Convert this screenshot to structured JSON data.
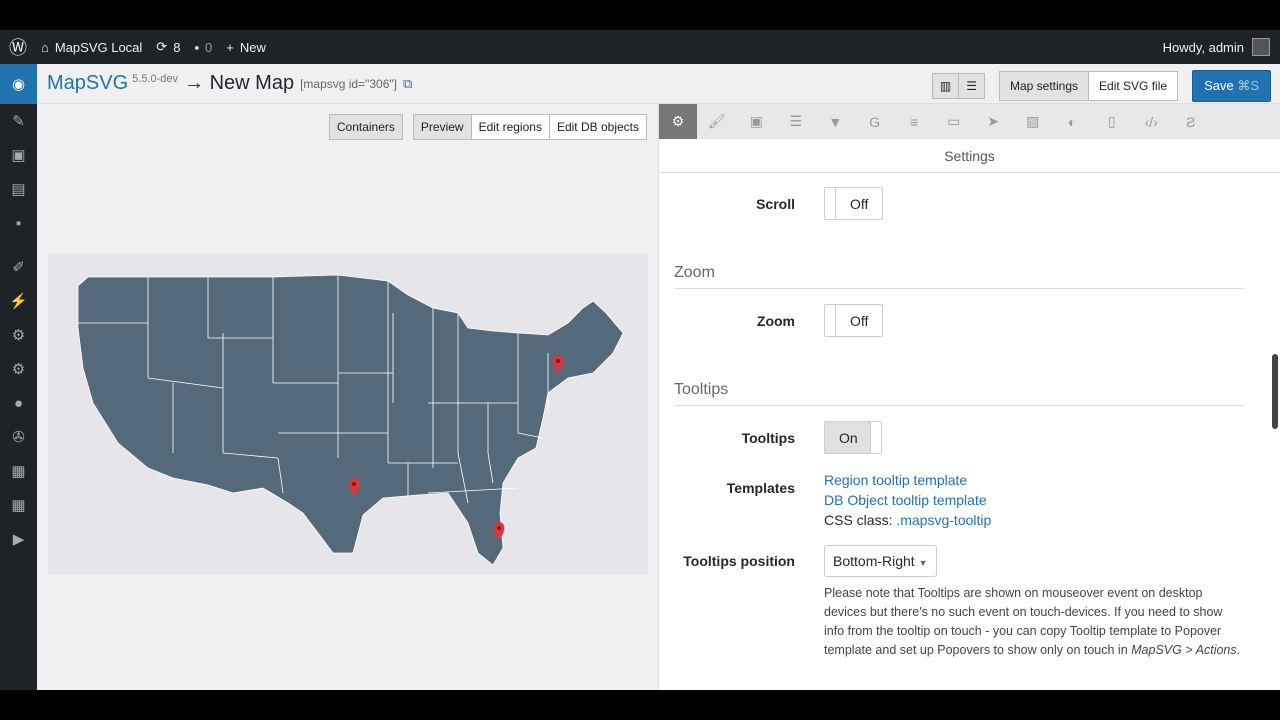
{
  "adminbar": {
    "site": "MapSVG Local",
    "updates": "8",
    "comments": "0",
    "new": "New",
    "howdy": "Howdy, admin"
  },
  "header": {
    "brand": "MapSVG",
    "version": "5.5.0-dev",
    "title": "→ New Map",
    "shortcode": "[mapsvg id=\"306\"]",
    "map_settings": "Map settings",
    "edit_svg": "Edit SVG file",
    "save": "Save",
    "save_shortcut": "⌘S"
  },
  "left": {
    "containers": "Containers",
    "preview": "Preview",
    "edit_regions": "Edit regions",
    "edit_db": "Edit DB objects"
  },
  "right": {
    "settings_title": "Settings",
    "scroll_label": "Scroll",
    "scroll_value": "Off",
    "zoom_section": "Zoom",
    "zoom_label": "Zoom",
    "zoom_value": "Off",
    "tooltips_section": "Tooltips",
    "tooltips_label": "Tooltips",
    "tooltips_value": "On",
    "templates_label": "Templates",
    "region_tpl": "Region tooltip template",
    "db_tpl": "DB Object tooltip template",
    "css_prefix": "CSS class: ",
    "css_class": ".mapsvg-tooltip",
    "position_label": "Tooltips position",
    "position_value": "Bottom-Right",
    "note": "Please note that Tooltips are shown on mouseover event on desktop devices but there's no such event on touch-devices. If you need to show info from the tooltip on touch - you can copy Tooltip template to Popover template and set up Popovers to show only on touch in ",
    "note_path": "MapSVG > Actions",
    "note_end": "."
  },
  "colors": {
    "accent": "#2271b1",
    "map": "#546a7b",
    "pin": "#d9363e"
  }
}
